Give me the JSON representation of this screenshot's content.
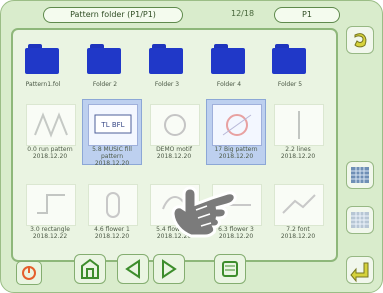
{
  "header": {
    "title_pill": "Pattern folder (P1/P1)",
    "counter": "12/18",
    "page_pill": "P1"
  },
  "folders": [
    {
      "label": "Pattern1.fol"
    },
    {
      "label": "Folder 2"
    },
    {
      "label": "Folder 3"
    },
    {
      "label": "Folder 4"
    },
    {
      "label": "Folder 5"
    }
  ],
  "thumbs_row1": [
    {
      "caption": "0.0\nrun pattern\n2018.12.20"
    },
    {
      "caption": "5.8 MUSIC\nfill pattern\n2018.12.20"
    },
    {
      "caption": "DEMO\nmotif\n2018.12.20"
    },
    {
      "caption": "17\nBig pattern\n2018.12.20"
    },
    {
      "caption": "2.2\nlines\n2018.12.20"
    }
  ],
  "thumbs_row2": [
    {
      "caption": "3.0\nrectangle\n2018.12.22"
    },
    {
      "caption": "4.6\nflower 1\n2018.12.20"
    },
    {
      "caption": "5.4\nflower 2\n2018.12.20"
    },
    {
      "caption": "6.3\nflower 3\n2018.12.20"
    },
    {
      "caption": "7.2\nfont 2018.12.20"
    }
  ],
  "sidebar": {
    "top_icon": "undo",
    "mid_icon_1": "grid",
    "mid_icon_2": "grid-alt",
    "bottom_icon": "enter"
  },
  "bottom_bar": {
    "left_icon": "power",
    "home": "home",
    "prev": "previous",
    "next": "next",
    "settings": "settings"
  }
}
